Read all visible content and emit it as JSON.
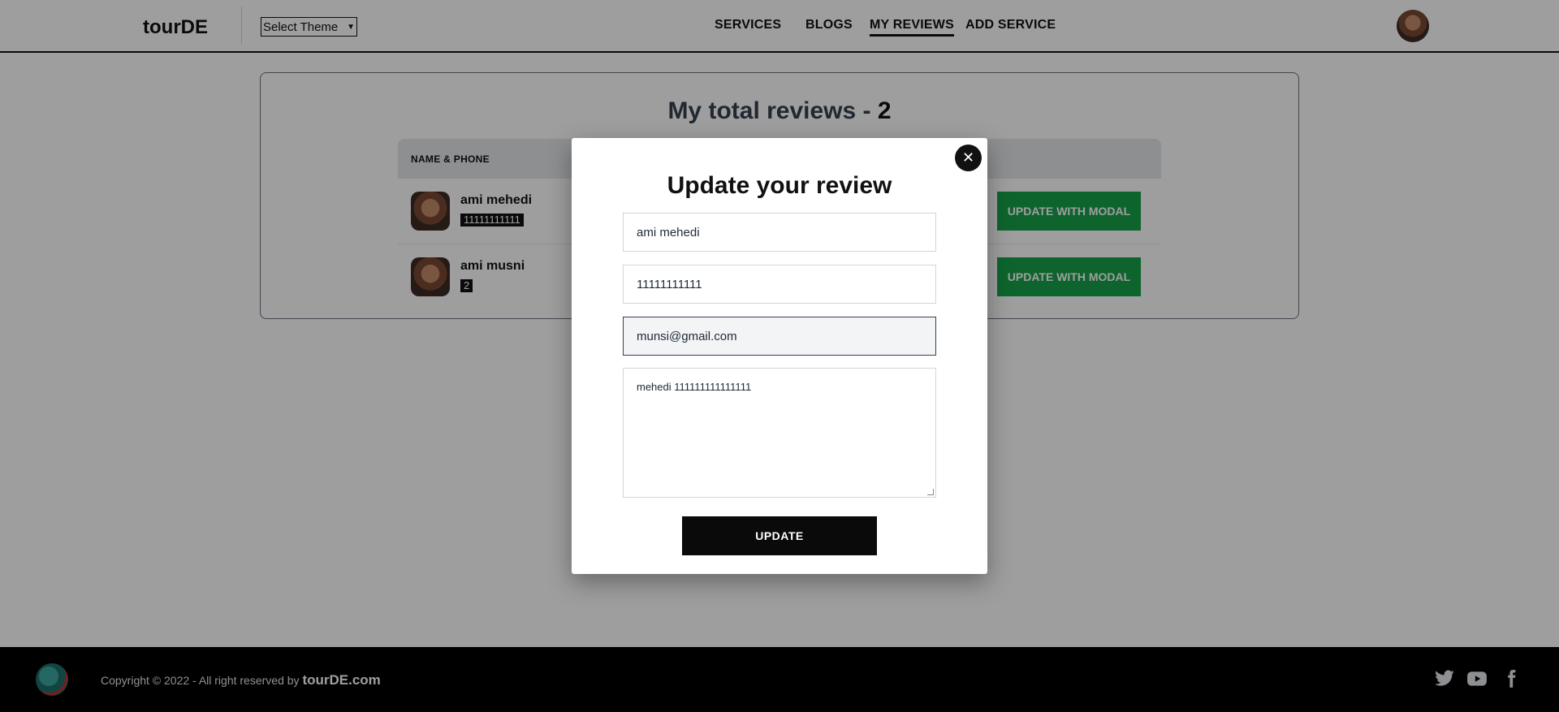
{
  "header": {
    "brand": "tourDE",
    "theme_select": "Select Theme",
    "nav": [
      "SERVICES",
      "BLOGS",
      "MY REVIEWS",
      "ADD SERVICE"
    ],
    "active_nav": "MY REVIEWS"
  },
  "reviews": {
    "title_prefix": "My total reviews - ",
    "count": "2",
    "column_header": "NAME & PHONE",
    "rows": [
      {
        "name": "ami mehedi",
        "phone": "11111111111",
        "button": "UPDATE WITH MODAL"
      },
      {
        "name": "ami musni",
        "phone": "2",
        "button": "UPDATE WITH MODAL"
      }
    ]
  },
  "modal": {
    "close_symbol": "✕",
    "title": "Update your review",
    "name_value": "ami mehedi",
    "phone_value": "11111111111",
    "email_value": "munsi@gmail.com",
    "review_text": "mehedi 111111111111111",
    "submit_label": "UPDATE"
  },
  "footer": {
    "copyright": "Copyright © 2022 - All right reserved by ",
    "brand": "tourDE.com",
    "social_icons": [
      "twitter-icon",
      "youtube-icon",
      "facebook-icon"
    ]
  },
  "colors": {
    "accent_green": "#16a34a",
    "dark": "#111111",
    "overlay": "rgba(0,0,0,0.38)"
  }
}
